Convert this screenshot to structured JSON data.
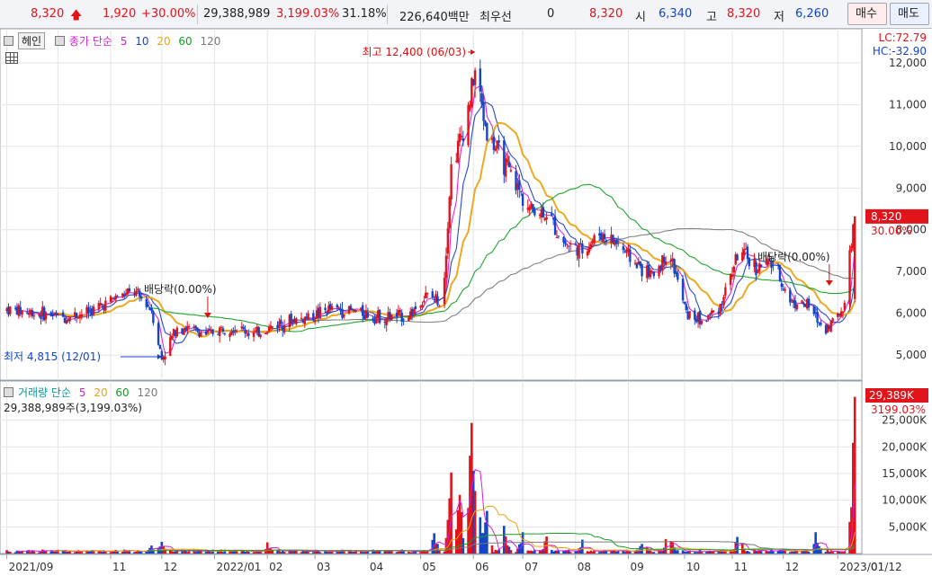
{
  "topbar": {
    "price": "8,320",
    "up_arrow": "arrow-up-icon",
    "change": "1,920",
    "change_pct": "+30.00%",
    "volume": "29,388,989",
    "volume_pct": "3,199.03%",
    "turnover": "31.18%",
    "amount": "226,640백만",
    "best_bid_label": "최우선",
    "best_bid_qty": "0",
    "last": "8,320",
    "open_label": "시",
    "open": "6,340",
    "high_label": "고",
    "high": "8,320",
    "low_label": "저",
    "low": "6,260",
    "buy_label": "매수",
    "sell_label": "매도"
  },
  "price_panel": {
    "legend_box": "헤인",
    "legend_title": "종가 단순",
    "ma": [
      {
        "label": "5",
        "color": "#d81ed8"
      },
      {
        "label": "10",
        "color": "#2040c8"
      },
      {
        "label": "20",
        "color": "#eaa514"
      },
      {
        "label": "60",
        "color": "#14a022"
      },
      {
        "label": "120",
        "color": "#7a7a7a"
      }
    ],
    "lc": "LC:72.79",
    "hc": "HC:-32.90",
    "last_price_tag": "8,320",
    "last_pct_tag": "30.00%",
    "high_annotation": "최고 12,400 (06/03)",
    "low_annotation": "최저 4,815 (12/01)",
    "dividend_1": "배당락(0.00%)",
    "dividend_2": "배당락(0.00%)"
  },
  "volume_panel": {
    "legend_title": "거래량 단순",
    "ma": [
      {
        "label": "5",
        "color": "#d81ed8"
      },
      {
        "label": "20",
        "color": "#eaa514"
      },
      {
        "label": "60",
        "color": "#14a022"
      },
      {
        "label": "120",
        "color": "#7a7a7a"
      }
    ],
    "subtitle": "29,388,989주(3,199.03%)",
    "last_volume_tag": "29,389K",
    "last_pct_tag": "3199.03%"
  },
  "colors": {
    "up": "#e1141c",
    "down": "#1646c8",
    "accent_tag": "#e1141c"
  },
  "chart_data": [
    {
      "type": "candlestick",
      "title": "",
      "ylim": [
        4400,
        12600
      ],
      "yticks": [
        "5,000",
        "6,000",
        "7,000",
        "8,000",
        "9,000",
        "10,000",
        "11,000",
        "12,000"
      ],
      "ytick_values": [
        5000,
        6000,
        7000,
        8000,
        9000,
        10000,
        11000,
        12000
      ],
      "x_labels": [
        "2021/09",
        "11",
        "12",
        "2022/01",
        "02",
        "03",
        "04",
        "05",
        "06",
        "07",
        "08",
        "09",
        "10",
        "11",
        "12",
        "2023/01",
        "01/12"
      ],
      "close_series": [
        {
          "d": "2021-09-01",
          "c": 6100
        },
        {
          "d": "2021-09-20",
          "c": 6000
        },
        {
          "d": "2021-10-05",
          "c": 5900
        },
        {
          "d": "2021-10-20",
          "c": 6050
        },
        {
          "d": "2021-11-05",
          "c": 6400
        },
        {
          "d": "2021-11-15",
          "c": 6500
        },
        {
          "d": "2021-11-25",
          "c": 6100
        },
        {
          "d": "2021-12-01",
          "c": 4900
        },
        {
          "d": "2021-12-10",
          "c": 5700
        },
        {
          "d": "2021-12-28",
          "c": 5500
        },
        {
          "d": "2022-01-10",
          "c": 5700
        },
        {
          "d": "2022-01-25",
          "c": 5500
        },
        {
          "d": "2022-02-10",
          "c": 5800
        },
        {
          "d": "2022-02-25",
          "c": 5900
        },
        {
          "d": "2022-03-10",
          "c": 6100
        },
        {
          "d": "2022-03-25",
          "c": 6050
        },
        {
          "d": "2022-04-10",
          "c": 5900
        },
        {
          "d": "2022-04-25",
          "c": 5950
        },
        {
          "d": "2022-05-05",
          "c": 6400
        },
        {
          "d": "2022-05-15",
          "c": 6300
        },
        {
          "d": "2022-05-20",
          "c": 9500
        },
        {
          "d": "2022-05-28",
          "c": 10500
        },
        {
          "d": "2022-06-03",
          "c": 11800
        },
        {
          "d": "2022-06-10",
          "c": 10300
        },
        {
          "d": "2022-06-20",
          "c": 9600
        },
        {
          "d": "2022-06-28",
          "c": 9000
        },
        {
          "d": "2022-07-05",
          "c": 8500
        },
        {
          "d": "2022-07-15",
          "c": 8400
        },
        {
          "d": "2022-07-25",
          "c": 7700
        },
        {
          "d": "2022-08-05",
          "c": 7500
        },
        {
          "d": "2022-08-15",
          "c": 7900
        },
        {
          "d": "2022-08-25",
          "c": 7700
        },
        {
          "d": "2022-09-05",
          "c": 7200
        },
        {
          "d": "2022-09-15",
          "c": 6900
        },
        {
          "d": "2022-09-25",
          "c": 7500
        },
        {
          "d": "2022-10-05",
          "c": 6000
        },
        {
          "d": "2022-10-15",
          "c": 5800
        },
        {
          "d": "2022-10-25",
          "c": 6200
        },
        {
          "d": "2022-11-05",
          "c": 7500
        },
        {
          "d": "2022-11-15",
          "c": 7100
        },
        {
          "d": "2022-11-25",
          "c": 7200
        },
        {
          "d": "2022-12-05",
          "c": 6300
        },
        {
          "d": "2022-12-15",
          "c": 6200
        },
        {
          "d": "2022-12-25",
          "c": 5600
        },
        {
          "d": "2023-01-05",
          "c": 6100
        },
        {
          "d": "2023-01-12",
          "c": 8320
        }
      ]
    },
    {
      "type": "bar",
      "title": "",
      "ylim": [
        0,
        30000
      ],
      "yticks": [
        "5,000K",
        "10,000K",
        "15,000K",
        "20,000K",
        "25,000K"
      ],
      "ytick_values": [
        5000,
        10000,
        15000,
        20000,
        25000
      ],
      "volume_k": [
        {
          "d": "2021-11-25",
          "v": 1500
        },
        {
          "d": "2021-12-01",
          "v": 2200
        },
        {
          "d": "2022-02-01",
          "v": 2100
        },
        {
          "d": "2022-05-10",
          "v": 3800
        },
        {
          "d": "2022-05-20",
          "v": 15200
        },
        {
          "d": "2022-05-25",
          "v": 11000
        },
        {
          "d": "2022-06-01",
          "v": 24500
        },
        {
          "d": "2022-06-05",
          "v": 12800
        },
        {
          "d": "2022-06-10",
          "v": 8000
        },
        {
          "d": "2022-06-20",
          "v": 5200
        },
        {
          "d": "2022-07-01",
          "v": 4000
        },
        {
          "d": "2022-07-15",
          "v": 3200
        },
        {
          "d": "2022-08-05",
          "v": 2600
        },
        {
          "d": "2022-09-10",
          "v": 3000
        },
        {
          "d": "2022-09-25",
          "v": 5600
        },
        {
          "d": "2022-11-05",
          "v": 5700
        },
        {
          "d": "2022-12-20",
          "v": 4000
        },
        {
          "d": "2023-01-12",
          "v": 29389
        }
      ]
    }
  ]
}
